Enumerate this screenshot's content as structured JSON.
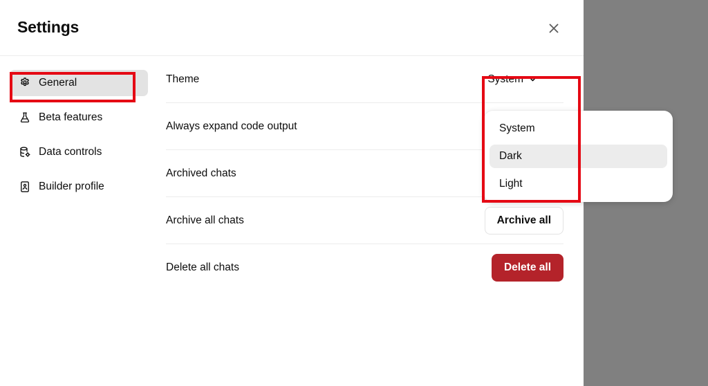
{
  "window": {
    "title": "Settings",
    "close_icon": "close-icon",
    "backdrop_color": "#808080",
    "panel_color": "#ffffff"
  },
  "sidebar": {
    "items": [
      {
        "label": "General",
        "icon": "gear-icon",
        "active": true
      },
      {
        "label": "Beta features",
        "icon": "flask-icon",
        "active": false
      },
      {
        "label": "Data controls",
        "icon": "database-gear-icon",
        "active": false
      },
      {
        "label": "Builder profile",
        "icon": "id-card-icon",
        "active": false
      }
    ]
  },
  "settings": {
    "rows": [
      {
        "label": "Theme",
        "control": "select"
      },
      {
        "label": "Always expand code output",
        "control": "none"
      },
      {
        "label": "Archived chats",
        "control": "none"
      },
      {
        "label": "Archive all chats",
        "control": "outline-button"
      },
      {
        "label": "Delete all chats",
        "control": "danger-button"
      }
    ],
    "theme_select": {
      "value": "System",
      "chevron_icon": "chevron-down-icon",
      "options": [
        {
          "label": "System",
          "highlighted": false
        },
        {
          "label": "Dark",
          "highlighted": true
        },
        {
          "label": "Light",
          "highlighted": false
        }
      ]
    },
    "archive_all_button": "Archive all",
    "delete_all_button": "Delete all"
  },
  "annotations": {
    "color": "#e50914",
    "boxes": [
      {
        "name": "general-sidebar-item-highlight"
      },
      {
        "name": "theme-dropdown-highlight"
      }
    ]
  }
}
